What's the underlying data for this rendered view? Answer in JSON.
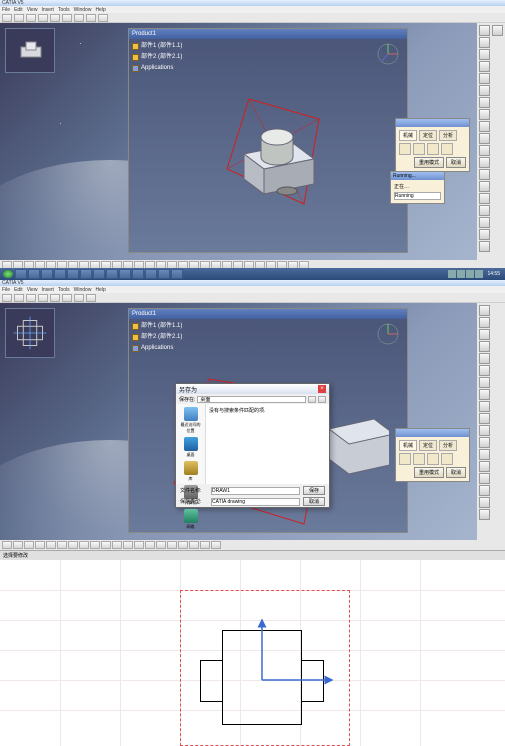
{
  "app": {
    "title": "CATIA V5"
  },
  "menu": {
    "file": "File",
    "edit": "Edit",
    "view": "View",
    "insert": "Insert",
    "tools": "Tools",
    "window": "Window",
    "help": "Help"
  },
  "viewport": {
    "title": "Product1",
    "tree": {
      "item1": "部件1 (部件1.1)",
      "item2": "部件2 (部件2.1)",
      "item3": "Applications"
    }
  },
  "panel1": {
    "tab1": "机械",
    "tab2": "定位",
    "tab3": "分析",
    "btn1": "重用模式",
    "btn2": "取消"
  },
  "panel2": {
    "title": "Running...",
    "label": "正在…",
    "value": "Running"
  },
  "file_dialog": {
    "title": "另存为",
    "addr_label": "保存在:",
    "addr_value": "桌面",
    "places": {
      "p1": "最近访问的位置",
      "p2": "桌面",
      "p3": "库",
      "p4": "计算机",
      "p5": "网络"
    },
    "list_msg": "没有与搜索条件匹配的项.",
    "filename_label": "文件名称:",
    "filename_value": "DRAW1",
    "filetype_label": "保存类型:",
    "filetype_value": "CATIA drawing",
    "save_btn": "保存",
    "cancel_btn": "取消"
  },
  "status": {
    "text": "选择要修改"
  },
  "taskbar": {
    "time": "14:55"
  }
}
